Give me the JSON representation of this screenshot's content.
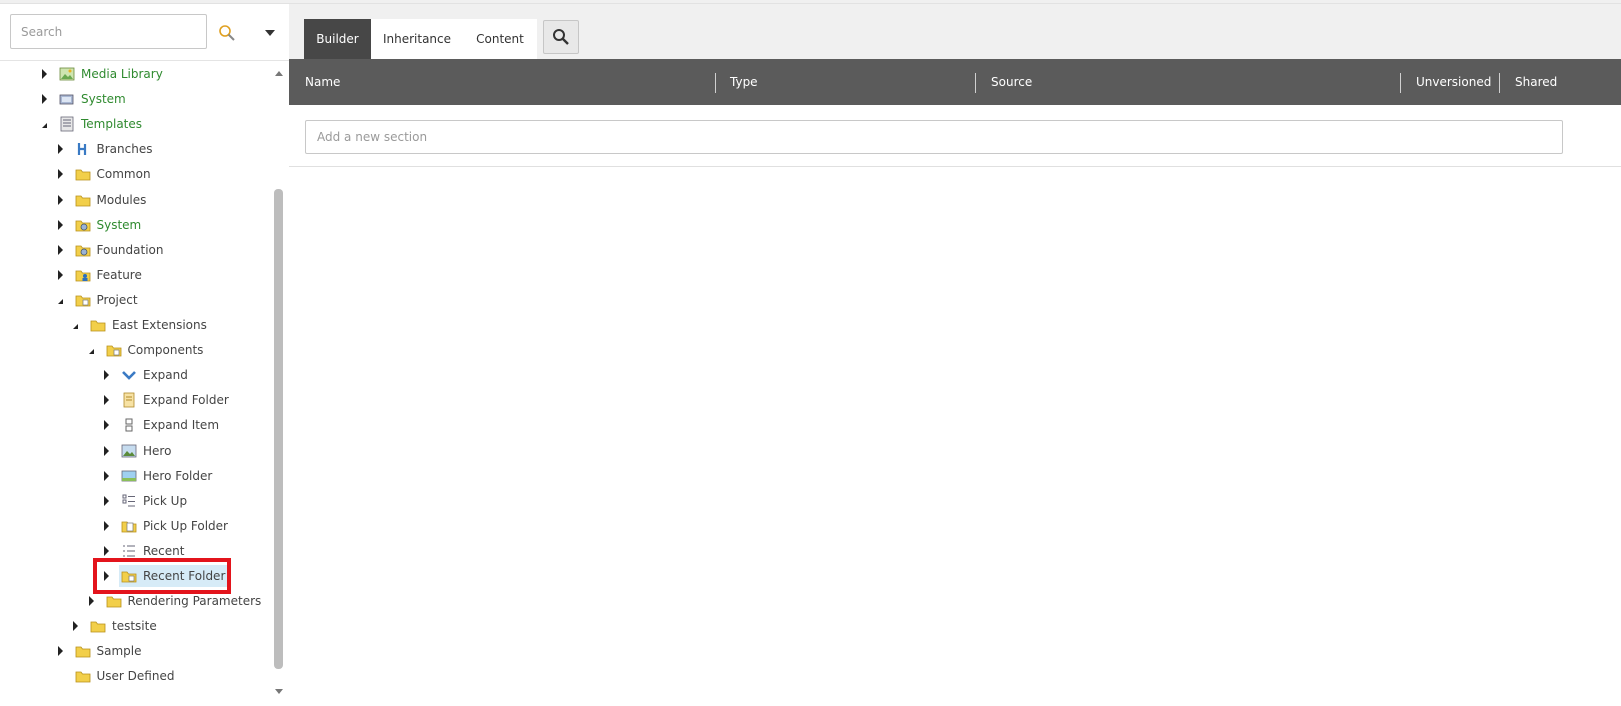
{
  "search": {
    "placeholder": "Search"
  },
  "tabs": [
    {
      "label": "Builder",
      "active": true
    },
    {
      "label": "Inheritance",
      "active": false
    },
    {
      "label": "Content",
      "active": false
    }
  ],
  "grid": {
    "columns": [
      "Name",
      "Type",
      "Source",
      "Unversioned",
      "Shared"
    ],
    "add_section_placeholder": "Add a new section"
  },
  "tree": [
    {
      "label": "Media Library",
      "color": "green",
      "expand": "collapsed",
      "icon": "media-library-icon"
    },
    {
      "label": "System",
      "color": "green",
      "expand": "collapsed",
      "icon": "system-icon"
    },
    {
      "label": "Templates",
      "color": "green",
      "expand": "expanded",
      "icon": "templates-icon"
    },
    {
      "label": "Branches",
      "color": "dark",
      "expand": "collapsed",
      "icon": "branches-icon"
    },
    {
      "label": "Common",
      "color": "dark",
      "expand": "collapsed",
      "icon": "folder-icon"
    },
    {
      "label": "Modules",
      "color": "dark",
      "expand": "collapsed",
      "icon": "folder-icon"
    },
    {
      "label": "System",
      "color": "green",
      "expand": "collapsed",
      "icon": "folder-gear-icon"
    },
    {
      "label": "Foundation",
      "color": "dark",
      "expand": "collapsed",
      "icon": "folder-gear-icon"
    },
    {
      "label": "Feature",
      "color": "dark",
      "expand": "collapsed",
      "icon": "folder-user-icon"
    },
    {
      "label": "Project",
      "color": "dark",
      "expand": "expanded",
      "icon": "folder-template-icon"
    },
    {
      "label": "East Extensions",
      "color": "dark",
      "expand": "expanded",
      "icon": "folder-icon"
    },
    {
      "label": "Components",
      "color": "dark",
      "expand": "expanded",
      "icon": "folder-template-icon"
    },
    {
      "label": "Expand",
      "color": "dark",
      "expand": "collapsed",
      "icon": "chevron-icon"
    },
    {
      "label": "Expand Folder",
      "color": "dark",
      "expand": "collapsed",
      "icon": "document-icon"
    },
    {
      "label": "Expand Item",
      "color": "dark",
      "expand": "collapsed",
      "icon": "item-icon"
    },
    {
      "label": "Hero",
      "color": "dark",
      "expand": "collapsed",
      "icon": "image-icon"
    },
    {
      "label": "Hero Folder",
      "color": "dark",
      "expand": "collapsed",
      "icon": "image-folder-icon"
    },
    {
      "label": "Pick Up",
      "color": "dark",
      "expand": "collapsed",
      "icon": "list-icon"
    },
    {
      "label": "Pick Up Folder",
      "color": "dark",
      "expand": "collapsed",
      "icon": "folder-doc-icon"
    },
    {
      "label": "Recent",
      "color": "dark",
      "expand": "collapsed",
      "icon": "numbered-list-icon"
    },
    {
      "label": "Recent Folder",
      "color": "dark",
      "expand": "collapsed",
      "icon": "folder-template-icon",
      "selected": true
    },
    {
      "label": "Rendering Parameters",
      "color": "dark",
      "expand": "collapsed",
      "icon": "folder-icon"
    },
    {
      "label": "testsite",
      "color": "dark",
      "expand": "collapsed",
      "icon": "folder-icon"
    },
    {
      "label": "Sample",
      "color": "dark",
      "expand": "collapsed",
      "icon": "folder-icon"
    },
    {
      "label": "User Defined",
      "color": "dark",
      "expand": "none",
      "icon": "folder-icon"
    }
  ]
}
